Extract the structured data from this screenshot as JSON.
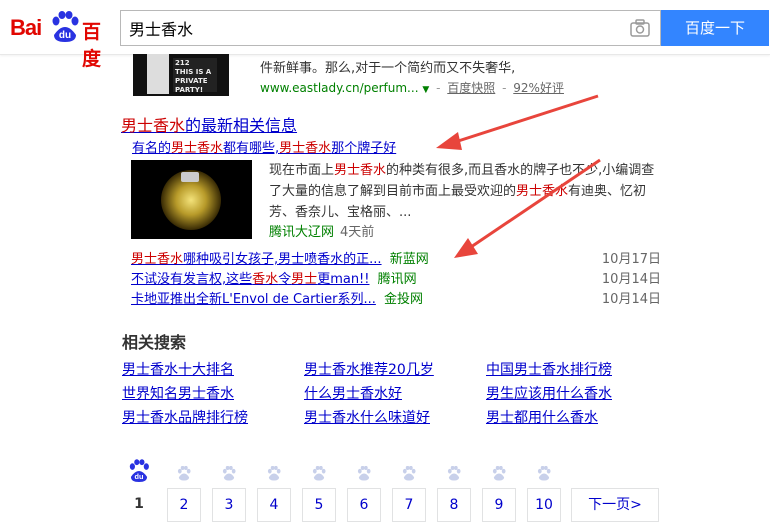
{
  "header": {
    "logo_text_1": "Bai",
    "logo_text_du": "du",
    "logo_text_2": "百度",
    "search_value": "男士香水",
    "search_button": "百度一下"
  },
  "top_result": {
    "thumb_label_1": "212",
    "thumb_label_2": "THIS IS A PRIVATE PARTY! NYC",
    "snippet": "件新鲜事。那么,对于一个简约而又不失奢华,",
    "url": "www.eastlady.cn/perfum...",
    "cache": "百度快照",
    "rating": "92%好评"
  },
  "news": {
    "title_hl": "男士香水",
    "title_rest": "的最新相关信息",
    "sub_pre": "有名的",
    "sub_hl1": "男士香水",
    "sub_mid": "都有哪些,",
    "sub_hl2": "男士香水",
    "sub_post": "那个牌子好",
    "desc_1": "现在市面上",
    "desc_hl1": "男士香水",
    "desc_2": "的种类有很多,而且香水的牌子也不少,小编调查了大量的信息了解到目前市面上最受欢迎的",
    "desc_hl2": "男士香水",
    "desc_3": "有迪奥、忆初芳、香奈儿、宝格丽、...",
    "source": "腾讯大辽网",
    "time": "4天前",
    "items": [
      {
        "t1": "男士香水",
        "t2": "哪种吸引女孩子,男士喷香水的正...",
        "source": "新蓝网",
        "date": "10月17日"
      },
      {
        "t1": "不试没有发言权,这些",
        "t2": "香水",
        "t3": "令",
        "t4": "男士",
        "t5": "更man!!",
        "source": "腾讯网",
        "date": "10月14日"
      },
      {
        "t1": "卡地亚推出全新L'Envol de Cartier系列...",
        "source": "金投网",
        "date": "10月14日"
      }
    ]
  },
  "related": {
    "title": "相关搜索",
    "links": [
      "男士香水十大排名",
      "男士香水推荐20几岁",
      "中国男士香水排行榜",
      "世界知名男士香水",
      "什么男士香水好",
      "男生应该用什么香水",
      "男士香水品牌排行榜",
      "男士香水什么味道好",
      "男士都用什么香水"
    ]
  },
  "pagination": {
    "pages": [
      "1",
      "2",
      "3",
      "4",
      "5",
      "6",
      "7",
      "8",
      "9",
      "10"
    ],
    "current": "1",
    "next": "下一页>"
  },
  "colors": {
    "brand": "#e10601",
    "button": "#3385ff",
    "link": "#0000cc",
    "highlight": "#cc0000",
    "source": "#008000",
    "arrow": "#e8453c"
  }
}
